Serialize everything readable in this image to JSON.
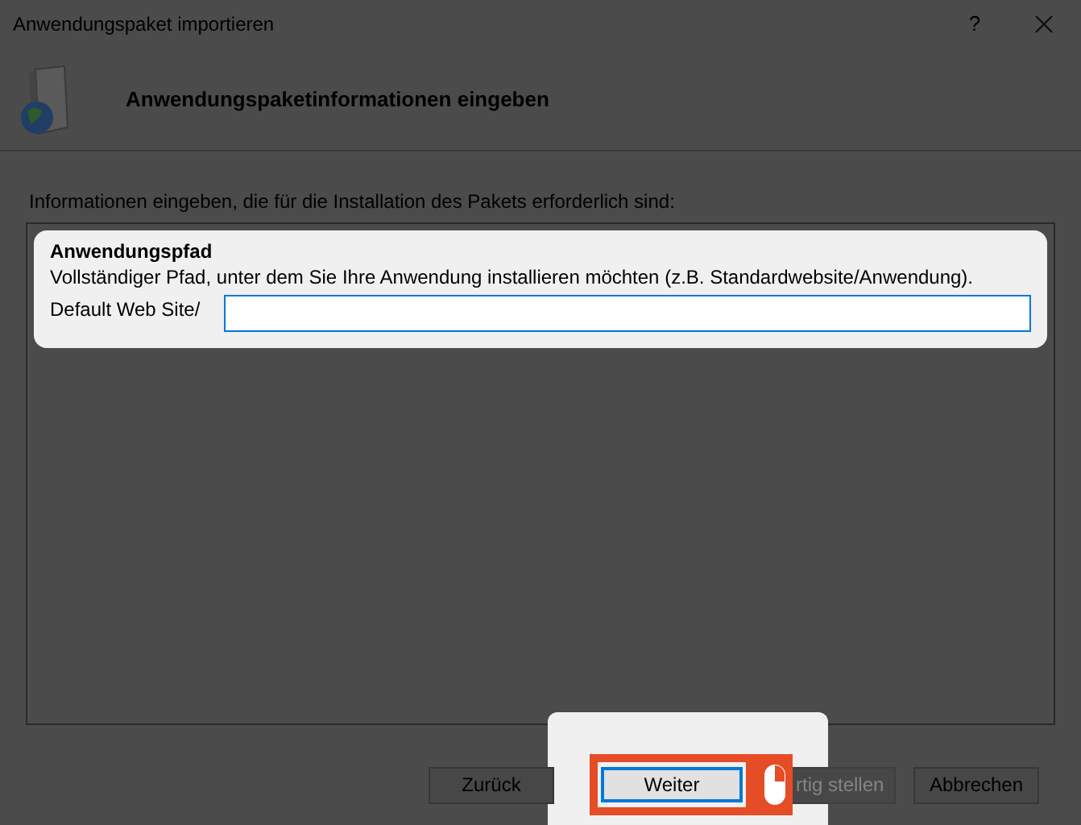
{
  "window": {
    "title": "Anwendungspaket importieren",
    "help": "?"
  },
  "header": {
    "title": "Anwendungspaketinformationen eingeben"
  },
  "instruction": "Informationen eingeben, die für die Installation des Pakets erforderlich sind:",
  "parameter": {
    "title": "Anwendungspfad",
    "description": "Vollständiger Pfad, unter dem Sie Ihre Anwendung installieren möchten (z.B. Standardwebsite/Anwendung).",
    "prefix": "Default Web Site/"
  },
  "buttons": [
    {
      "label": "Zurück",
      "disabled": false,
      "highlighted": false
    },
    {
      "label": "Weiter",
      "disabled": false,
      "highlighted": true
    },
    {
      "label": "rtig stellen",
      "disabled": true,
      "highlighted": false
    },
    {
      "label": "Abbrechen",
      "disabled": false,
      "highlighted": false
    }
  ]
}
